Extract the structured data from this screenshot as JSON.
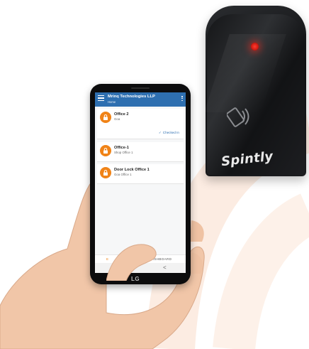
{
  "app": {
    "company": "Mrinq Technologies LLP",
    "screen": "Home"
  },
  "cards": [
    {
      "title": "Office 2",
      "subtitle": "Goa",
      "status": "Checked In"
    },
    {
      "title": "Office-1",
      "subtitle": "Shop Office 1"
    },
    {
      "title": "Door Lock Office 1",
      "subtitle": "Goa Office 1"
    }
  ],
  "bottom_nav": {
    "left": "E",
    "right": "ASHBOARD"
  },
  "system_nav": {
    "back": "<"
  },
  "phone_brand": "LG",
  "reader_brand": "Spintly",
  "colors": {
    "appbar": "#2e6fb0",
    "accent": "#f08317",
    "led": "#ff3b30"
  }
}
